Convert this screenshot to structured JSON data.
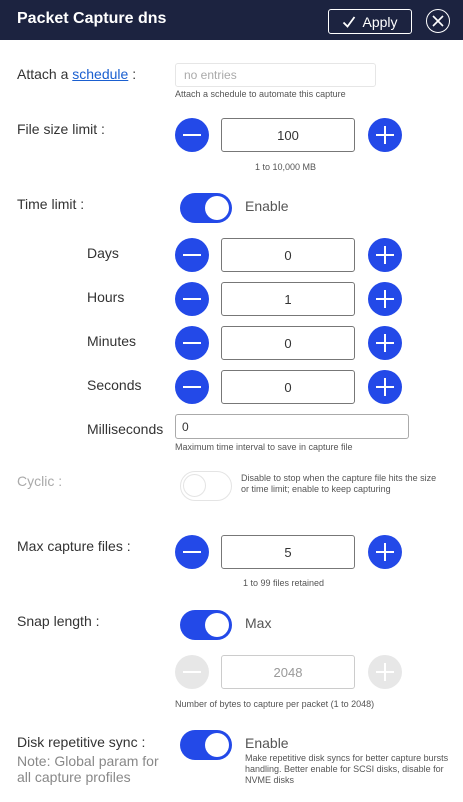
{
  "header": {
    "title": "Packet Capture dns",
    "apply_label": "Apply"
  },
  "schedule": {
    "label_prefix": "Attach a",
    "link": "schedule",
    "label_suffix": ":",
    "placeholder": "no entries",
    "hint": "Attach a schedule to automate this capture"
  },
  "file_size": {
    "label": "File size limit :",
    "value": "100",
    "hint": "1 to 10,000 MB"
  },
  "time_limit": {
    "label": "Time limit :",
    "toggle_label": "Enable",
    "enabled": true,
    "days": {
      "label": "Days",
      "value": "0"
    },
    "hours": {
      "label": "Hours",
      "value": "1"
    },
    "minutes": {
      "label": "Minutes",
      "value": "0"
    },
    "seconds": {
      "label": "Seconds",
      "value": "0"
    },
    "milliseconds": {
      "label": "Milliseconds",
      "value": "0",
      "hint": "Maximum time interval to save in capture file"
    }
  },
  "cyclic": {
    "label": "Cyclic :",
    "enabled": false,
    "hint": "Disable to stop when the capture file hits the size or time limit; enable to keep capturing"
  },
  "max_files": {
    "label": "Max capture files :",
    "value": "5",
    "hint": "1 to 99 files retained"
  },
  "snap_length": {
    "label": "Snap length :",
    "toggle_label": "Max",
    "enabled": true,
    "value": "2048",
    "hint": "Number of bytes to capture per packet (1 to 2048)"
  },
  "disk_sync": {
    "label": "Disk repetitive sync :",
    "note": "Note: Global param for all capture profiles",
    "toggle_label": "Enable",
    "enabled": true,
    "hint": "Make repetitive disk syncs for better capture bursts handling. Better enable for SCSI disks, disable for NVME disks"
  },
  "colors": {
    "header_bg": "#1c2340",
    "accent": "#2349e8",
    "link": "#1a5fd0"
  },
  "icons": {
    "apply": "check-icon",
    "close": "close-circle-icon",
    "decrement": "minus-icon",
    "increment": "plus-icon"
  }
}
